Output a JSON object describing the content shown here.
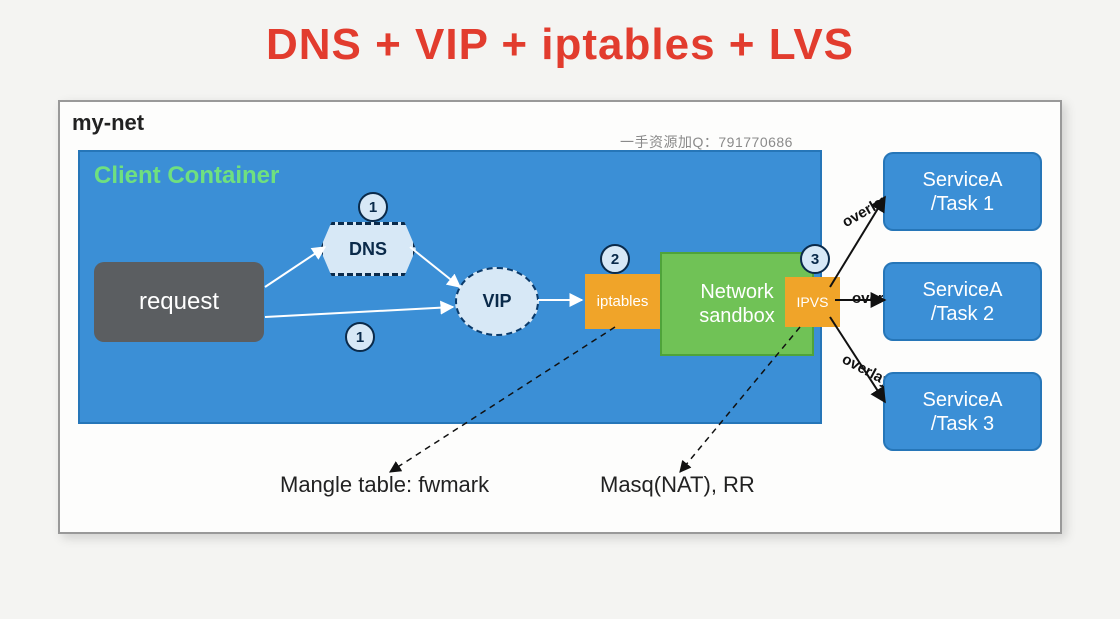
{
  "title": "DNS + VIP + iptables + LVS",
  "net_label": "my-net",
  "client_label": "Client Container",
  "request": "request",
  "dns": "DNS",
  "vip": "VIP",
  "iptables": "iptables",
  "sandbox": "Network sandbox",
  "ipvs": "IPVS",
  "steps": {
    "s1a": "1",
    "s1b": "1",
    "s2": "2",
    "s3": "3"
  },
  "overlay": "overlay",
  "services": [
    {
      "name": "ServiceA",
      "task": "/Task 1"
    },
    {
      "name": "ServiceA",
      "task": "/Task 2"
    },
    {
      "name": "ServiceA",
      "task": "/Task 3"
    }
  ],
  "captions": {
    "mangle": "Mangle table: fwmark",
    "masq": "Masq(NAT), RR"
  },
  "watermark": "一手资源加Q：791770686"
}
